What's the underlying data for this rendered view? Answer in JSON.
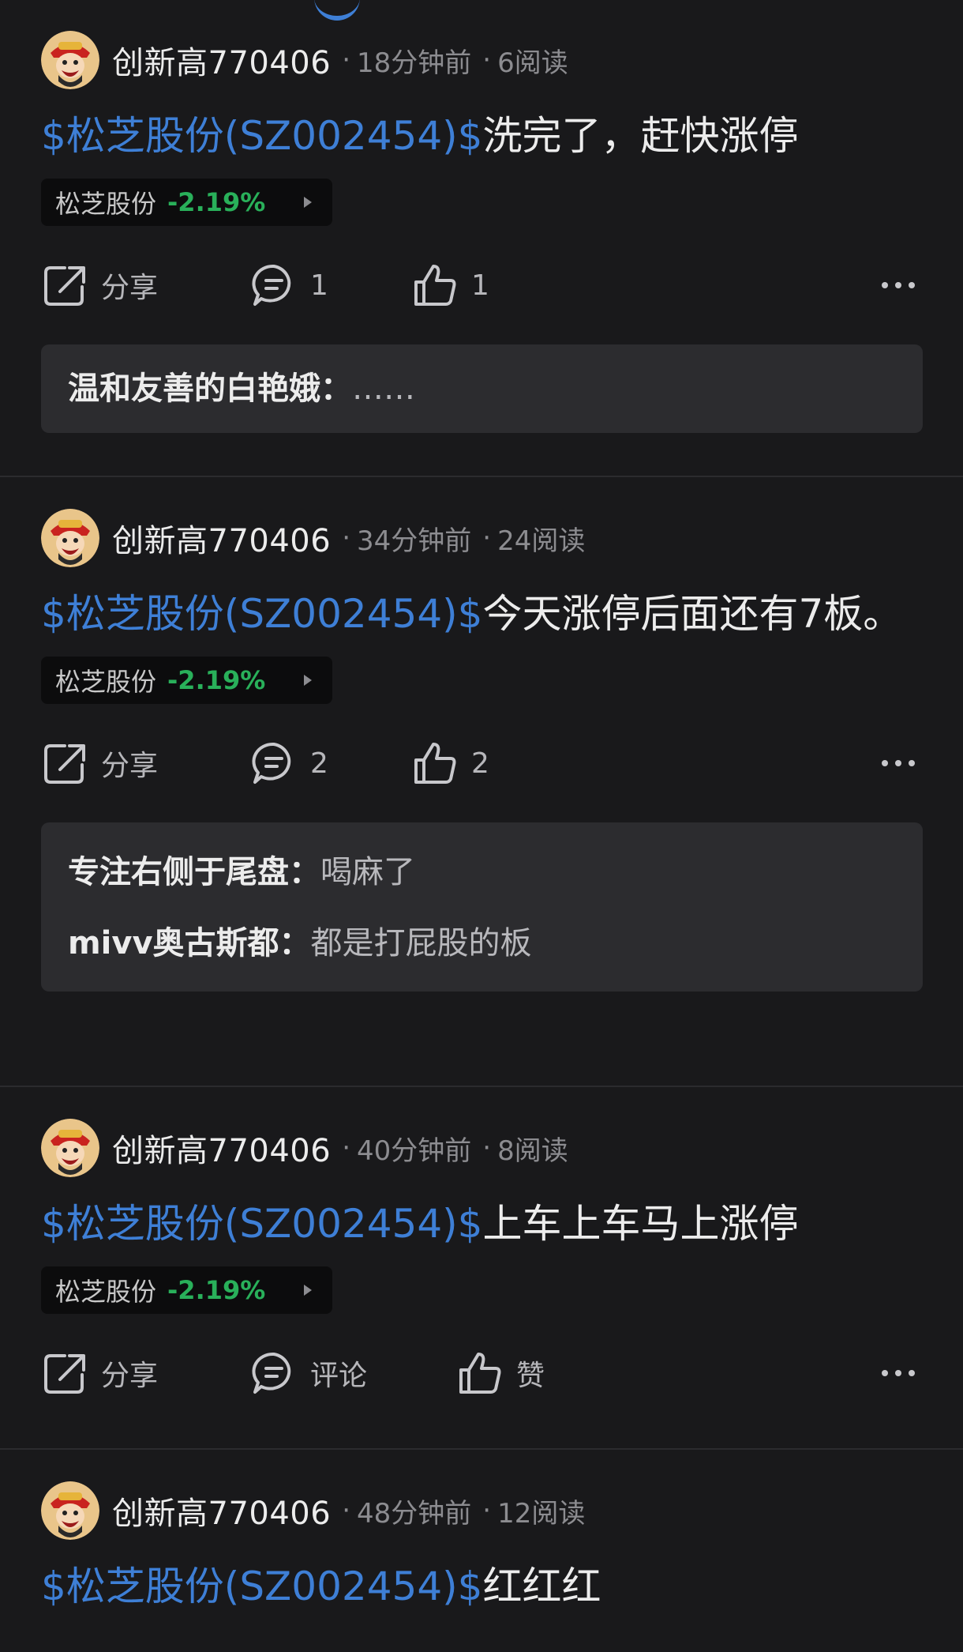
{
  "posts": [
    {
      "author": "创新高770406",
      "time": "18分钟前",
      "reads": "6阅读",
      "stock_tag": "$松芝股份(SZ002454)$",
      "text": "洗完了，赶快涨停",
      "chip": {
        "name": "松芝股份",
        "change": "-2.19%"
      },
      "share_label": "分享",
      "comment_label": "1",
      "like_label": "1",
      "replies": [
        {
          "author": "温和友善的白艳娥：",
          "text": "……"
        }
      ]
    },
    {
      "author": "创新高770406",
      "time": "34分钟前",
      "reads": "24阅读",
      "stock_tag": "$松芝股份(SZ002454)$",
      "text": "今天涨停后面还有7板。",
      "chip": {
        "name": "松芝股份",
        "change": "-2.19%"
      },
      "share_label": "分享",
      "comment_label": "2",
      "like_label": "2",
      "replies": [
        {
          "author": "专注右侧于尾盘：",
          "text": "喝麻了"
        },
        {
          "author": "mivv奥古斯都：",
          "text": "都是打屁股的板"
        }
      ]
    },
    {
      "author": "创新高770406",
      "time": "40分钟前",
      "reads": "8阅读",
      "stock_tag": "$松芝股份(SZ002454)$",
      "text": "上车上车马上涨停",
      "chip": {
        "name": "松芝股份",
        "change": "-2.19%"
      },
      "share_label": "分享",
      "comment_label": "评论",
      "like_label": "赞",
      "replies": []
    },
    {
      "author": "创新高770406",
      "time": "48分钟前",
      "reads": "12阅读",
      "stock_tag": "$松芝股份(SZ002454)$",
      "text": "红红红"
    }
  ],
  "colors": {
    "background": "#19191b",
    "link": "#3e7fd6",
    "down_green": "#29b05a",
    "reply_bg": "#2c2c2f"
  },
  "icons": [
    "avatar-caishen-icon",
    "share-icon",
    "comment-icon",
    "like-icon",
    "more-icon",
    "chevron-right-icon"
  ]
}
